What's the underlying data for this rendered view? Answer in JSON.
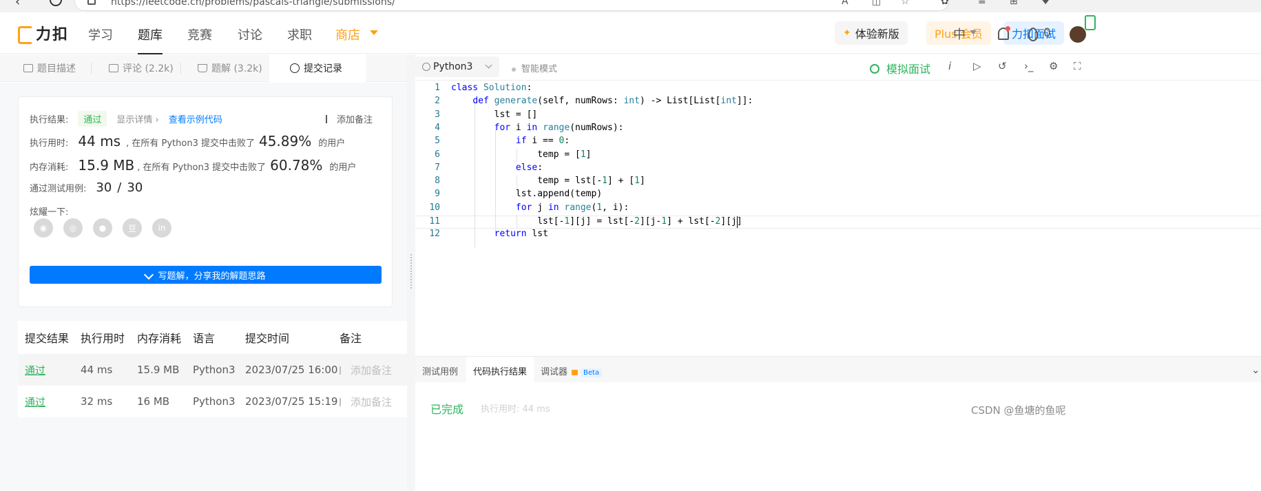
{
  "browser": {
    "url": "https://leetcode.cn/problems/pascals-triangle/submissions/"
  },
  "nav": {
    "logo": "力扣",
    "items": [
      "学习",
      "题库",
      "竞赛",
      "讨论",
      "求职"
    ],
    "shop": "商店",
    "trial": "体验新版",
    "plus": "Plus 会员",
    "mock": "力扣面试",
    "lang": "中",
    "streak": "0"
  },
  "tabs": {
    "desc": "题目描述",
    "comments": "评论 (2.2k)",
    "solutions": "题解 (3.2k)",
    "submissions": "提交记录"
  },
  "result": {
    "label_result": "执行结果:",
    "status": "通过",
    "show_details": "显示详情 ›",
    "sample_code": "查看示例代码",
    "add_note": "添加备注",
    "label_time": "执行用时:",
    "time_value": "44 ms",
    "time_mid": ", 在所有 Python3 提交中击败了",
    "time_pct": "45.89%",
    "users": "的用户",
    "label_mem": "内存消耗:",
    "mem_value": "15.9 MB",
    "mem_mid": ", 在所有 Python3 提交中击败了",
    "mem_pct": "60.78%",
    "label_cases": "通过测试用例:",
    "cases_pass": "30",
    "cases_sep": "/",
    "cases_total": "30",
    "share_label": "炫耀一下:",
    "write_solution": "写题解，分享我的解题思路"
  },
  "table": {
    "headers": [
      "提交结果",
      "执行用时",
      "内存消耗",
      "语言",
      "提交时间",
      "备注"
    ],
    "rows": [
      {
        "status": "通过",
        "time": "44 ms",
        "memory": "15.9 MB",
        "lang": "Python3",
        "submitted": "2023/07/25 16:00",
        "note": "添加备注"
      },
      {
        "status": "通过",
        "time": "32 ms",
        "memory": "16 MB",
        "lang": "Python3",
        "submitted": "2023/07/25 15:19",
        "note": "添加备注"
      }
    ]
  },
  "editor": {
    "language": "Python3",
    "smart_mode": "智能模式",
    "mock_interview": "模拟面试",
    "code_lines": [
      "class Solution:",
      "    def generate(self, numRows: int) -> List[List[int]]:",
      "        lst = []",
      "        for i in range(numRows):",
      "            if i == 0:",
      "                temp = [1]",
      "            else:",
      "                temp = lst[-1] + [1]",
      "            lst.append(temp)",
      "            for j in range(1, i):",
      "                lst[-1][j] = lst[-2][j-1] + lst[-2][j]",
      "        return lst"
    ],
    "current_line": 11
  },
  "bottom": {
    "tab_testcase": "测试用例",
    "tab_result": "代码执行结果",
    "tab_debugger": "调试器",
    "beta": "Beta",
    "done": "已完成",
    "exec_time": "执行用时: 44 ms"
  },
  "watermark": "CSDN @鱼塘的鱼呢"
}
